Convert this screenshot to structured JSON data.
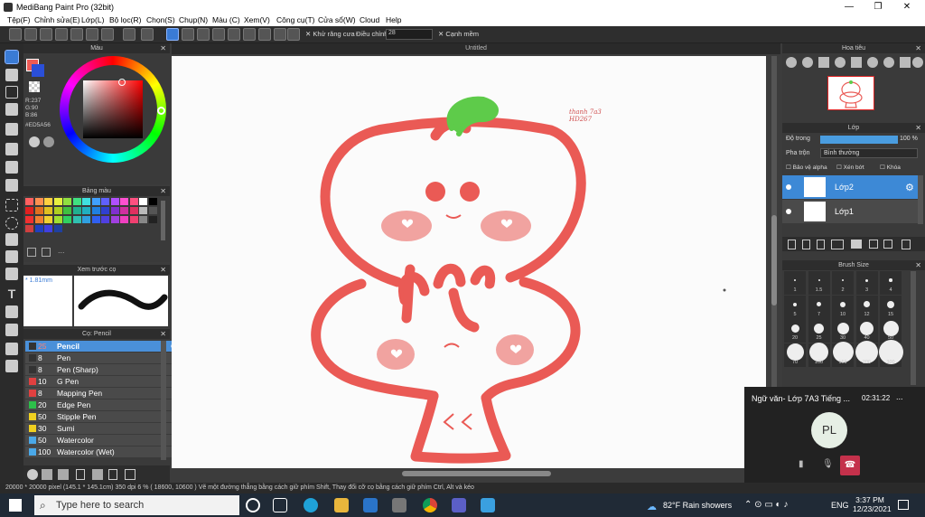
{
  "window": {
    "title": "MediBang Paint Pro (32bit)",
    "minimize": "—",
    "restore": "❐",
    "close": "✕"
  },
  "menu": [
    "Tệp(F)",
    "Chỉnh sửa(E)",
    "Lớp(L)",
    "Bộ lọc(R)",
    "Chọn(S)",
    "Chụp(N)",
    "Màu (C)",
    "Xem(V)",
    "Công cụ(T)",
    "Cửa sổ(W)",
    "Cloud",
    "Help"
  ],
  "toolbar": {
    "antialias_label": "Khử răng cưa",
    "adjust_label": "Điều chỉnh",
    "adjust_value": "28",
    "snap_label": "Cạnh mềm"
  },
  "color_panel": {
    "title": "Màu",
    "r": "R:237",
    "g": "G:90",
    "b": "B:86",
    "hex": "#ED5A56",
    "primary_color": "#ed5a56",
    "secondary_color": "#2a4fd8"
  },
  "palette_panel": {
    "title": "Bảng màu",
    "more": "..."
  },
  "preview_panel": {
    "title": "Xem trước cọ",
    "size": "1.81mm"
  },
  "brush_panel": {
    "title": "Cọ: Pencil",
    "brushes": [
      {
        "size": "25",
        "name": "Pencil",
        "color": "#333333",
        "selected": true
      },
      {
        "size": "8",
        "name": "Pen",
        "color": "#333333"
      },
      {
        "size": "8",
        "name": "Pen (Sharp)",
        "color": "#333333"
      },
      {
        "size": "10",
        "name": "G Pen",
        "color": "#e04040"
      },
      {
        "size": "8",
        "name": "Mapping Pen",
        "color": "#e04040"
      },
      {
        "size": "20",
        "name": "Edge Pen",
        "color": "#2dbf4a"
      },
      {
        "size": "50",
        "name": "Stipple Pen",
        "color": "#f0d020"
      },
      {
        "size": "30",
        "name": "Sumi",
        "color": "#f0d020"
      },
      {
        "size": "50",
        "name": "Watercolor",
        "color": "#4aa8e8"
      },
      {
        "size": "100",
        "name": "Watercolor (Wet)",
        "color": "#4aa8e8"
      }
    ]
  },
  "canvas": {
    "title": "Untitled",
    "signature": "thanh 7a3 HD267"
  },
  "navigator": {
    "title": "Hoa tiêu"
  },
  "layers_panel": {
    "title": "Lớp",
    "opacity_label": "Độ trong",
    "opacity_value": "100 %",
    "opacity_fraction": 1.0,
    "blend_label": "Pha trộn",
    "blend_value": "Bình thường",
    "protect_alpha": "Bảo vệ alpha",
    "clipping": "Xén bớt",
    "lock": "Khóa",
    "layers": [
      {
        "name": "Lớp2",
        "selected": true
      },
      {
        "name": "Lớp1",
        "selected": false
      }
    ]
  },
  "brush_size_panel": {
    "title": "Brush Size",
    "sizes": [
      "1",
      "1.5",
      "2",
      "3",
      "4",
      "5",
      "7",
      "10",
      "12",
      "15",
      "20",
      "25",
      "30",
      "40",
      "50",
      "70",
      "100",
      "150",
      "200",
      "300"
    ]
  },
  "status": {
    "size": "20000 * 20000 pixel",
    "physical": "(145.1 * 145.1cm)",
    "dpi": "350 dpi",
    "zoom": "6 %",
    "coords": "( 18600, 10600 )",
    "hint": "Vẽ một đường thẳng bằng cách giữ phím Shift, Thay đổi cỡ cọ bằng cách giữ phím Ctrl, Alt và kéo"
  },
  "call": {
    "title": "Ngữ văn- Lớp 7A3 Tiếng ...",
    "time": "02:31:22",
    "more": "...",
    "initials": "PL"
  },
  "taskbar": {
    "search_placeholder": "Type here to search",
    "weather": "82°F  Rain showers",
    "lang": "ENG",
    "time": "3:37 PM",
    "date": "12/23/2021"
  }
}
